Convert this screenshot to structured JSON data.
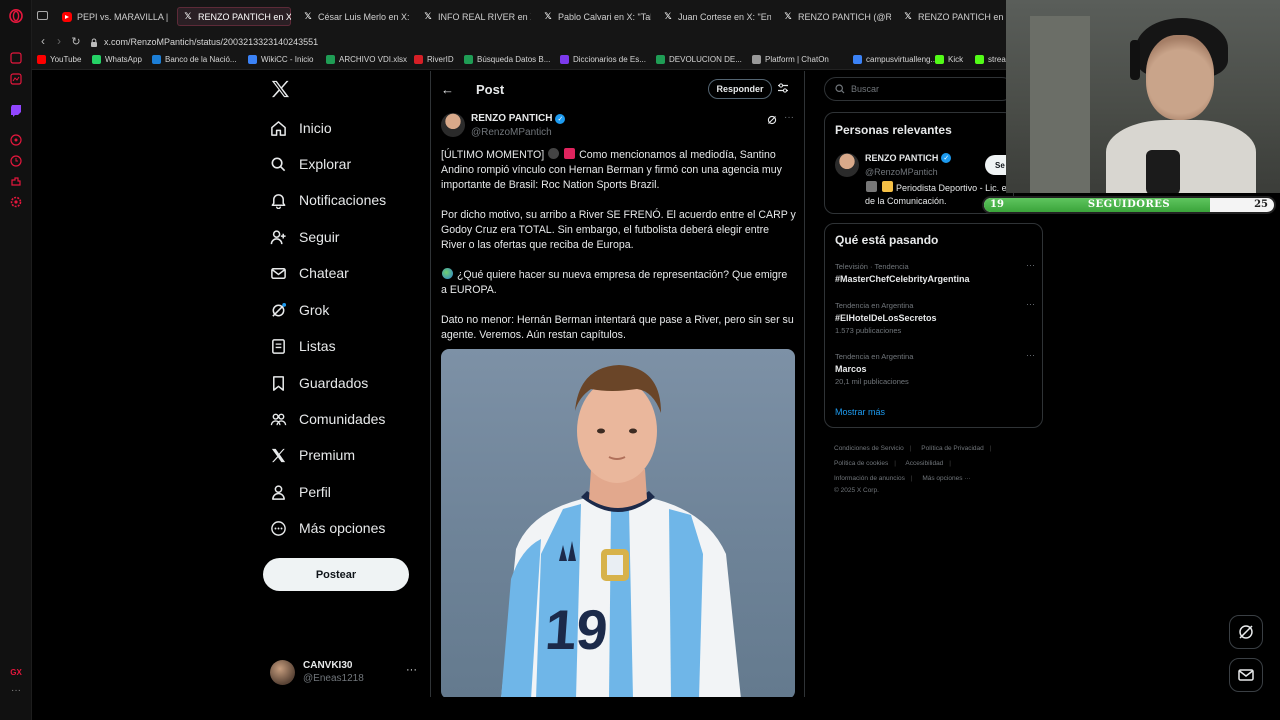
{
  "browser": {
    "tabs": [
      {
        "icon": "youtube-icon",
        "label": "PEPI vs. MARAVILLA | PAR"
      },
      {
        "icon": "x-icon",
        "label": "RENZO PANTICH en X: \"[Ú",
        "active": true
      },
      {
        "icon": "x-icon",
        "label": "César Luis Merlo en X: \""
      },
      {
        "icon": "x-icon",
        "label": "INFO REAL RIVER en X"
      },
      {
        "icon": "x-icon",
        "label": "Pablo Calvari en X: \"Tal c"
      },
      {
        "icon": "x-icon",
        "label": "Juan Cortese en X: \"En e"
      },
      {
        "icon": "x-icon",
        "label": "RENZO PANTICH (@Renz"
      },
      {
        "icon": "x-icon",
        "label": "RENZO PANTICH en X: \""
      }
    ],
    "url": "x.com/RenzoMPantich/status/2003213323140243551",
    "bookmarks": [
      {
        "label": "YouTube",
        "color": "#ff0000"
      },
      {
        "label": "WhatsApp",
        "color": "#25d366"
      },
      {
        "label": "Banco de la Nació...",
        "color": "#1c7ed6"
      },
      {
        "label": "WikiCC - Inicio",
        "color": "#3b82f6"
      },
      {
        "label": "ARCHIVO VDI.xlsx",
        "color": "#1f9d55"
      },
      {
        "label": "RiverID",
        "color": "#d61f26"
      },
      {
        "label": "Búsqueda Datos B...",
        "color": "#1f9d55"
      },
      {
        "label": "Diccionarios de Es...",
        "color": "#7c3aed"
      },
      {
        "label": "DEVOLUCION DE...",
        "color": "#1f9d55"
      },
      {
        "label": "Platform | ChatOn",
        "color": "#999999"
      },
      {
        "label": "campusvirtualleng...",
        "color": "#3b82f6"
      },
      {
        "label": "Kick",
        "color": "#53fc18"
      },
      {
        "label": "strea",
        "color": "#53fc18"
      }
    ],
    "sidebar_badge": "GX"
  },
  "nav": {
    "items": [
      {
        "label": "Inicio",
        "icon": "home-icon"
      },
      {
        "label": "Explorar",
        "icon": "search-icon"
      },
      {
        "label": "Notificaciones",
        "icon": "bell-icon"
      },
      {
        "label": "Seguir",
        "icon": "follow-icon"
      },
      {
        "label": "Chatear",
        "icon": "mail-icon"
      },
      {
        "label": "Grok",
        "icon": "grok-icon"
      },
      {
        "label": "Listas",
        "icon": "list-icon"
      },
      {
        "label": "Guardados",
        "icon": "bookmark-icon"
      },
      {
        "label": "Comunidades",
        "icon": "communities-icon"
      },
      {
        "label": "Premium",
        "icon": "x-icon"
      },
      {
        "label": "Perfil",
        "icon": "profile-icon"
      },
      {
        "label": "Más opciones",
        "icon": "more-options-icon"
      }
    ],
    "post_button": "Postear"
  },
  "account": {
    "name": "CANVKI30",
    "handle": "@Eneas1218",
    "more": "···"
  },
  "post_header": {
    "title": "Post",
    "reply_button": "Responder"
  },
  "post": {
    "author_name": "RENZO PANTICH",
    "author_handle": "@RenzoMPantich",
    "more": "···",
    "p1_a": "[ÚLTIMO MOMENTO]",
    "p1_b": "Como mencionamos al mediodía, Santino Andino rompió vínculo con Hernan Berman y firmó con una agencia muy importante de Brasil: Roc Nation Sports Brazil.",
    "p2": "Por dicho motivo, su arribo a River SE FRENÓ. El acuerdo entre el CARP y Godoy Cruz era TOTAL. Sin embargo, el futbolista deberá elegir entre River o las ofertas que reciba de Europa.",
    "p3": "¿Qué quiere hacer su nueva empresa de representación? Que emigre a EUROPA.",
    "p4": "Dato no menor: Hernán Berman intentará que pase a River, pero sin ser su agente. Veremos. Aún restan capítulos.",
    "image_jersey_number": "19"
  },
  "search": {
    "placeholder": "Buscar"
  },
  "relevant": {
    "title": "Personas relevantes",
    "name": "RENZO PANTICH",
    "handle": "@RenzoMPantich",
    "follow_button": "Se",
    "bio": "Periodista Deportivo - Lic. e de la Comunicación."
  },
  "trends": {
    "title": "Qué está pasando",
    "items": [
      {
        "meta": "Televisión · Tendencia",
        "name": "#MasterChefCelebrityArgentina",
        "count": ""
      },
      {
        "meta": "Tendencia en Argentina",
        "name": "#ElHotelDeLosSecretos",
        "count": "1.573 publicaciones"
      },
      {
        "meta": "Tendencia en Argentina",
        "name": "Marcos",
        "count": "20,1 mil publicaciones"
      }
    ],
    "more": "···",
    "show_more": "Mostrar más"
  },
  "footer": {
    "links": [
      "Condiciones de Servicio",
      "Política de Privacidad",
      "Política de cookies",
      "Accesibilidad",
      "Información de anuncios",
      "Más opciones ···"
    ],
    "copyright": "© 2025 X Corp."
  },
  "followers_bar": {
    "min": "19",
    "label": "SEGUIDORES",
    "max": "25",
    "progress": 0.78,
    "fill_color": "#4cb84c"
  },
  "colors": {
    "accent": "#1d9bf0",
    "background": "#000000",
    "border": "#2f3336",
    "muted_text": "#71767b"
  }
}
